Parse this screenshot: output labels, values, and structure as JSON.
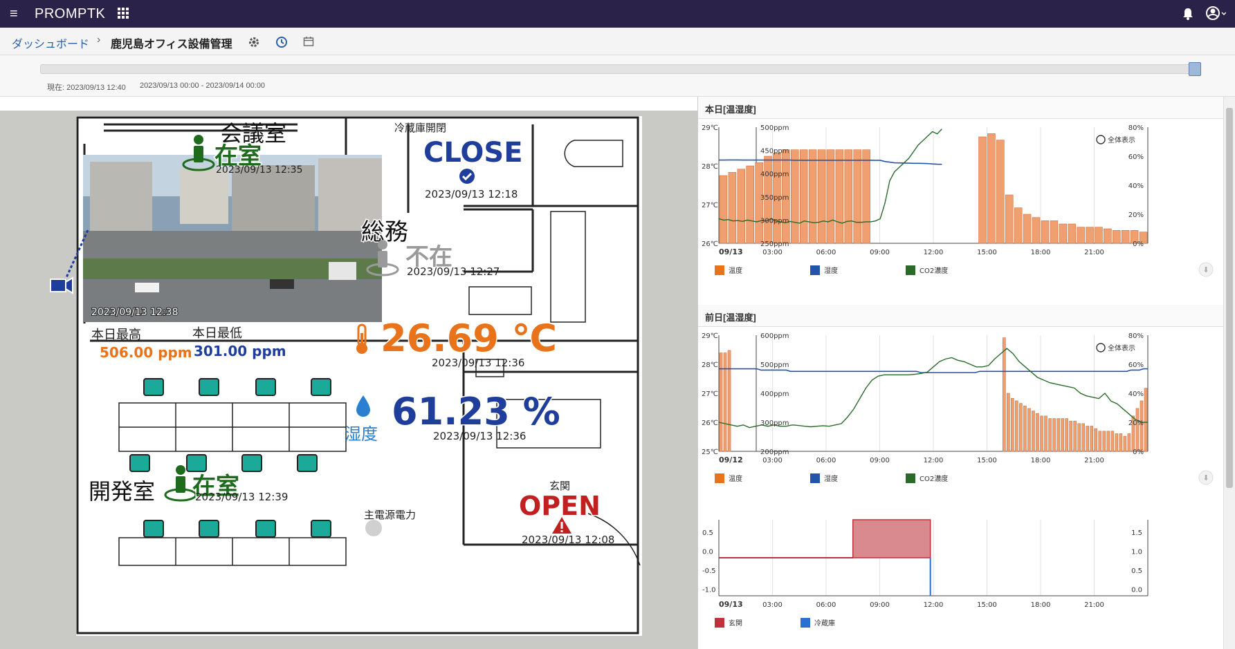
{
  "app": {
    "brand": "PROMPTK"
  },
  "breadcrumb": {
    "home": "ダッシュボード",
    "current": "鹿児島オフィス設備管理"
  },
  "timebar": {
    "now": "現在: 2023/09/13 12:40",
    "range": "2023/09/13 00:00 - 2023/09/14 00:00",
    "position": 1.0
  },
  "floor": {
    "meeting_room": {
      "label": "会議室",
      "status": "在室",
      "time": "2023/09/13 12:35"
    },
    "camera": {
      "time": "2023/09/13 12:38"
    },
    "fridge": {
      "label": "冷蔵庫開閉",
      "status": "CLOSE",
      "time": "2023/09/13 12:18"
    },
    "general_affairs": {
      "label": "総務",
      "status": "不在",
      "time": "2023/09/13 12:27"
    },
    "co2": {
      "max_label": "本日最高",
      "max_value": "506.00 ppm",
      "min_label": "本日最低",
      "min_value": "301.00 ppm"
    },
    "temperature": {
      "value": "26.69 ℃",
      "time": "2023/09/13 12:36"
    },
    "humidity": {
      "label": "湿度",
      "value": "61.23 %",
      "time": "2023/09/13 12:36"
    },
    "dev_room": {
      "label": "開発室",
      "status": "在室",
      "time": "2023/09/13 12:39"
    },
    "power": {
      "label": "主電源電力"
    },
    "entrance": {
      "label": "玄関",
      "status": "OPEN",
      "time": "2023/09/13 12:08"
    }
  },
  "colors": {
    "topbar": "#2a2248",
    "present": "#1e6b1e",
    "absent": "#9a9a9a",
    "temp": "#e8731a",
    "humid": "#1f3e9c",
    "alert": "#c0201f",
    "bar": "#f0a070",
    "humidLine": "#2255aa",
    "co2Line": "#2a6b2a",
    "door": "#c0303a",
    "fridgeLine": "#2a70d0"
  },
  "chart_data": [
    {
      "type": "bar",
      "title": "本日[温湿度]",
      "zoom_label": "全体表示",
      "x_start": "09/13",
      "x_ticks": [
        "03:00",
        "06:00",
        "09:00",
        "12:00",
        "15:00",
        "18:00",
        "21:00"
      ],
      "y_temp_ticks": [
        "26℃",
        "27℃",
        "28℃",
        "29℃"
      ],
      "y_co2_ticks": [
        "250ppm",
        "300ppm",
        "350ppm",
        "400ppm",
        "450ppm",
        "500ppm"
      ],
      "y_humid_ticks": [
        "0%",
        "20%",
        "40%",
        "60%",
        "80%"
      ],
      "legend": [
        "温度",
        "湿度",
        "CO2濃度"
      ],
      "series": [
        {
          "name": "温度",
          "values": [
            28.1,
            28.2,
            28.3,
            28.4,
            28.5,
            28.7,
            28.8,
            28.9,
            28.9,
            28.9,
            28.9,
            28.9,
            28.9,
            28.9,
            28.9,
            28.9,
            28.9,
            null,
            null,
            null,
            null,
            null,
            null,
            null,
            null,
            null,
            null,
            null,
            null,
            29.3,
            29.4,
            29.2,
            27.5,
            27.1,
            26.9,
            26.8,
            26.7,
            26.7,
            26.6,
            26.6,
            26.5,
            26.5,
            26.5,
            26.45,
            26.4,
            26.4,
            26.4,
            26.35
          ]
        },
        {
          "name": "湿度",
          "values": [
            64.5,
            64.5,
            64.6,
            64.6,
            64.6,
            64.5,
            64.5,
            64.5,
            64.5,
            64.5,
            64.5,
            64.5,
            64.5,
            64.5,
            64.5,
            64.5,
            64.4,
            64.4,
            64.4,
            64.4,
            64.4,
            64.4,
            64.4,
            64.4,
            64.4,
            64.4,
            64.4,
            64.4,
            64.4,
            64.4,
            64.4,
            64.4,
            64.4,
            64.3,
            64.3,
            63.4,
            62.9,
            62.4,
            62.3,
            62.2,
            62.1,
            62.0,
            62.0,
            61.9,
            61.8,
            61.5,
            61.3,
            61.2
          ]
        },
        {
          "name": "CO2濃度",
          "values": [
            305,
            302,
            303,
            300,
            301,
            299,
            302,
            300,
            298,
            301,
            300,
            305,
            300,
            298,
            296,
            299,
            297,
            295,
            300,
            298,
            296,
            297,
            300,
            298,
            302,
            298,
            295,
            299,
            300,
            297,
            297,
            298,
            298,
            300,
            305,
            340,
            390,
            410,
            420,
            430,
            440,
            455,
            470,
            480,
            490,
            500,
            495,
            506
          ]
        }
      ]
    },
    {
      "type": "bar",
      "title": "前日[温湿度]",
      "zoom_label": "全体表示",
      "x_start": "09/12",
      "x_ticks": [
        "03:00",
        "06:00",
        "09:00",
        "12:00",
        "15:00",
        "18:00",
        "21:00"
      ],
      "y_temp_ticks": [
        "25℃",
        "26℃",
        "27℃",
        "28℃",
        "29℃"
      ],
      "y_co2_ticks": [
        "200ppm",
        "300ppm",
        "400ppm",
        "500ppm",
        "600ppm"
      ],
      "y_humid_ticks": [
        "0%",
        "20%",
        "40%",
        "60%",
        "80%"
      ],
      "legend": [
        "温度",
        "湿度",
        "CO2濃度"
      ],
      "series": [
        {
          "name": "温度",
          "values": [
            28.9,
            28.9,
            29.0,
            null,
            null,
            null,
            null,
            null,
            null,
            null,
            null,
            null,
            null,
            null,
            null,
            null,
            null,
            null,
            null,
            null,
            null,
            null,
            null,
            null,
            null,
            null,
            null,
            null,
            null,
            null,
            null,
            null,
            null,
            null,
            null,
            null,
            null,
            null,
            null,
            null,
            null,
            null,
            null,
            null,
            null,
            null,
            null,
            null,
            null,
            null,
            null,
            null,
            null,
            null,
            null,
            null,
            null,
            null,
            null,
            null,
            null,
            null,
            null,
            null,
            null,
            null,
            null,
            null,
            29.5,
            27.3,
            27.1,
            27.0,
            26.9,
            26.8,
            26.7,
            26.6,
            26.5,
            26.4,
            26.4,
            26.3,
            26.3,
            26.3,
            26.3,
            26.3,
            26.2,
            26.2,
            26.1,
            26.1,
            26.0,
            26.0,
            25.9,
            25.8,
            25.8,
            25.8,
            25.8,
            25.7,
            25.7,
            25.6,
            25.7,
            26.4,
            26.7,
            27.0,
            27.5
          ]
        },
        {
          "name": "湿度",
          "values": [
            64,
            64,
            64,
            64,
            64,
            64,
            64,
            64,
            64,
            64,
            63,
            63,
            63,
            63,
            63,
            63,
            63,
            62,
            62,
            62,
            62,
            62,
            62,
            62,
            62,
            62,
            62,
            62,
            62,
            62,
            62,
            62,
            62,
            62,
            62,
            62,
            62,
            62,
            62,
            62,
            62,
            62,
            62,
            62,
            62,
            62,
            62,
            62,
            61,
            61,
            61,
            61,
            61,
            61,
            61,
            61,
            61,
            61,
            61,
            61,
            61,
            61,
            62,
            62,
            62,
            62,
            62,
            62,
            62,
            62,
            62,
            62,
            62,
            62,
            62,
            62,
            62,
            62,
            62,
            62,
            62,
            62,
            62,
            62,
            62,
            62,
            62,
            62,
            62,
            62,
            62,
            62,
            62,
            62,
            62,
            62,
            62,
            62,
            63,
            63,
            63,
            64,
            64
          ]
        },
        {
          "name": "CO2濃度",
          "values": [
            310,
            305,
            300,
            295,
            300,
            290,
            295,
            300,
            295,
            300,
            295,
            295,
            300,
            298,
            295,
            293,
            295,
            297,
            295,
            300,
            305,
            330,
            360,
            400,
            440,
            470,
            485,
            490,
            490,
            490,
            490,
            490,
            492,
            495,
            500,
            520,
            540,
            550,
            555,
            545,
            540,
            530,
            520,
            520,
            525,
            550,
            570,
            590,
            570,
            540,
            520,
            500,
            480,
            470,
            460,
            455,
            450,
            445,
            440,
            420,
            410,
            405,
            400,
            420,
            390,
            380,
            360,
            340,
            320,
            310,
            310
          ]
        }
      ]
    },
    {
      "type": "area",
      "title": "",
      "x_start": "09/13",
      "x_ticks": [
        "03:00",
        "06:00",
        "09:00",
        "12:00",
        "15:00",
        "18:00",
        "21:00"
      ],
      "y_left_ticks": [
        "-1.0",
        "-0.5",
        "0.0",
        "0.5"
      ],
      "y_right_ticks": [
        "0.0",
        "0.5",
        "1.0",
        "1.5"
      ],
      "legend": [
        "玄関",
        "冷蔵庫"
      ],
      "series": [
        {
          "name": "玄関",
          "segments": [
            {
              "from": "00:00",
              "to": "07:30",
              "value": 0
            },
            {
              "from": "07:30",
              "to": "11:50",
              "value": 1
            }
          ]
        },
        {
          "name": "冷蔵庫",
          "segments": [
            {
              "from": "11:50",
              "to": "11:50",
              "value": 1
            }
          ]
        }
      ]
    }
  ]
}
